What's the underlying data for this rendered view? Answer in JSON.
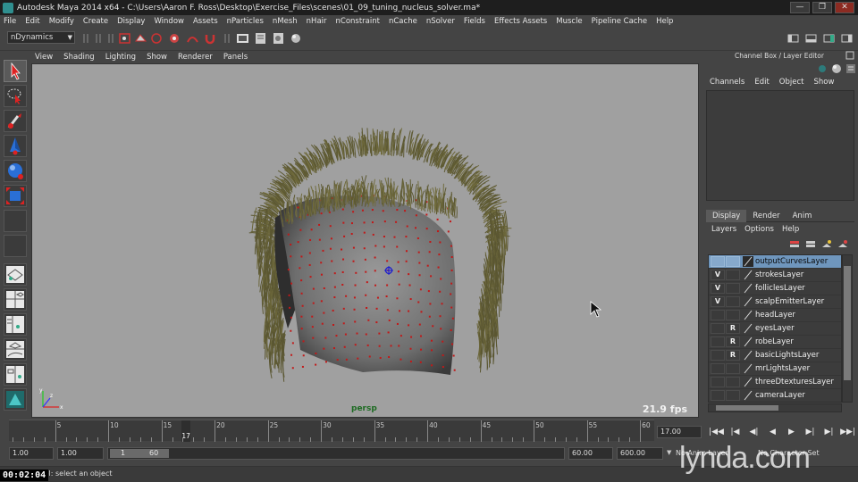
{
  "window": {
    "title": "Autodesk Maya 2014 x64 - C:\\Users\\Aaron F. Ross\\Desktop\\Exercise_Files\\scenes\\01_09_tuning_nucleus_solver.ma*",
    "buttons": [
      "minimize",
      "maximize",
      "close"
    ]
  },
  "menubar": {
    "items": [
      "File",
      "Edit",
      "Modify",
      "Create",
      "Display",
      "Window",
      "Assets",
      "nParticles",
      "nMesh",
      "nHair",
      "nConstraint",
      "nCache",
      "nSolver",
      "Fields",
      "Effects Assets",
      "Muscle",
      "Pipeline Cache",
      "Help"
    ]
  },
  "statusline": {
    "mode": "nDynamics"
  },
  "panel": {
    "menu": [
      "View",
      "Shading",
      "Lighting",
      "Show",
      "Renderer",
      "Panels"
    ],
    "camera": "persp",
    "fps": "21.9 fps"
  },
  "channel_box": {
    "title": "Channel Box / Layer Editor",
    "tabs": [
      "Channels",
      "Edit",
      "Object",
      "Show"
    ]
  },
  "layer_editor": {
    "tabs": [
      "Display",
      "Render",
      "Anim"
    ],
    "active_tab": "Display",
    "menu": [
      "Layers",
      "Options",
      "Help"
    ],
    "layers": [
      {
        "v": "",
        "p": "",
        "name": "outputCurvesLayer",
        "selected": true
      },
      {
        "v": "V",
        "p": "",
        "name": "strokesLayer",
        "selected": false
      },
      {
        "v": "V",
        "p": "",
        "name": "folliclesLayer",
        "selected": false
      },
      {
        "v": "V",
        "p": "",
        "name": "scalpEmitterLayer",
        "selected": false
      },
      {
        "v": "",
        "p": "",
        "name": "headLayer",
        "selected": false
      },
      {
        "v": "",
        "p": "R",
        "name": "eyesLayer",
        "selected": false
      },
      {
        "v": "",
        "p": "R",
        "name": "robeLayer",
        "selected": false
      },
      {
        "v": "",
        "p": "R",
        "name": "basicLightsLayer",
        "selected": false
      },
      {
        "v": "",
        "p": "",
        "name": "mrLightsLayer",
        "selected": false
      },
      {
        "v": "",
        "p": "",
        "name": "threeDtexturesLayer",
        "selected": false
      },
      {
        "v": "",
        "p": "",
        "name": "cameraLayer",
        "selected": false
      }
    ]
  },
  "timeline": {
    "ticks": [
      "5",
      "10",
      "15",
      "20",
      "25",
      "30",
      "35",
      "40",
      "45",
      "50",
      "55",
      "60"
    ],
    "current_frame": "17",
    "current_time": "17.00"
  },
  "range": {
    "start": "1.00",
    "playback_start": "1.00",
    "range_min": "1",
    "range_max": "60",
    "playback_end": "60.00",
    "end": "600.00",
    "anim_layer": "No Anim Layer",
    "character_set": "No Character Set"
  },
  "help_line": {
    "text": "Select Tool: select an object"
  },
  "overlay": {
    "timecode": "00:02:04",
    "watermark": "lynda.com"
  }
}
